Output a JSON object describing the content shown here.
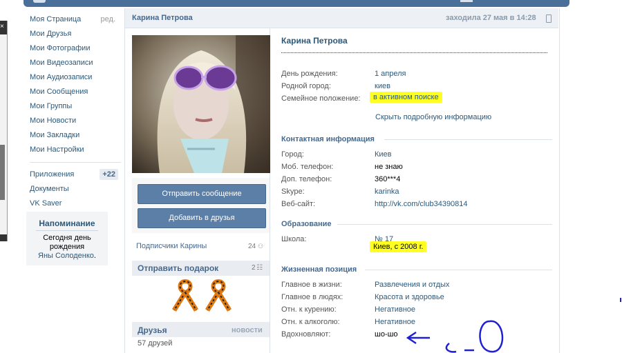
{
  "sidebar": {
    "items": [
      {
        "label": "Моя Страница",
        "edit": "ред."
      },
      {
        "label": "Мои Друзья"
      },
      {
        "label": "Мои Фотографии"
      },
      {
        "label": "Мои Видеозаписи"
      },
      {
        "label": "Мои Аудиозаписи"
      },
      {
        "label": "Мои Сообщения"
      },
      {
        "label": "Мои Группы"
      },
      {
        "label": "Мои Новости"
      },
      {
        "label": "Мои Закладки"
      },
      {
        "label": "Мои Настройки"
      }
    ],
    "extra": [
      {
        "label": "Приложения",
        "badge": "+22"
      },
      {
        "label": "Документы"
      },
      {
        "label": "VK Saver"
      }
    ],
    "reminder": {
      "title": "Напоминание",
      "prefix": "Сегодня",
      "birthday": "день рождения",
      "name1": "Яны",
      "name2": "Солоденко",
      "suffix": "."
    }
  },
  "header": {
    "name": "Карина Петрова",
    "status": "заходила 27 мая в 14:28"
  },
  "profile": {
    "buttons": {
      "message": "Отправить сообщение",
      "add_friend": "Добавить в друзья"
    },
    "subscribers": {
      "label": "Подписчики Карины",
      "count": "24"
    },
    "gifts": {
      "title": "Отправить подарок",
      "count": "2"
    },
    "friends": {
      "title": "Друзья",
      "news": "новости",
      "count": "57 друзей"
    },
    "name": "Карина Петрова",
    "basic": [
      {
        "label": "День рождения:",
        "value": "1 апреля"
      },
      {
        "label": "Родной город:",
        "value": "киев"
      },
      {
        "label": "Семейное положение:",
        "value": "в активном поиске"
      }
    ],
    "hide_info": "Скрыть подробную информацию",
    "contact": {
      "title": "Контактная информация",
      "rows": [
        {
          "label": "Город:",
          "value": "Киев"
        },
        {
          "label": "Моб. телефон:",
          "value": "не знаю"
        },
        {
          "label": "Доп. телефон:",
          "value": "360***4"
        },
        {
          "label": "Skype:",
          "value": "karinka"
        },
        {
          "label": "Веб-сайт:",
          "value": "http://vk.com/club34390814"
        }
      ]
    },
    "education": {
      "title": "Образование",
      "label": "Школа:",
      "school": "№ 17",
      "school_detail": "Киев, с 2008 г."
    },
    "position": {
      "title": "Жизненная позиция",
      "rows": [
        {
          "label": "Главное в жизни:",
          "value": "Развлечения и отдых"
        },
        {
          "label": "Главное в людях:",
          "value": "Красота и здоровье"
        },
        {
          "label": "Отн. к курению:",
          "value": "Негативное"
        },
        {
          "label": "Отн. к алкоголю:",
          "value": "Негативное"
        },
        {
          "label": "Вдохновляют:",
          "value": "шо-шо"
        }
      ]
    }
  },
  "colors": {
    "accent": "#45688e",
    "link": "#2b587a",
    "highlight": "#ffff22",
    "scribble": "#1f1fd8"
  }
}
